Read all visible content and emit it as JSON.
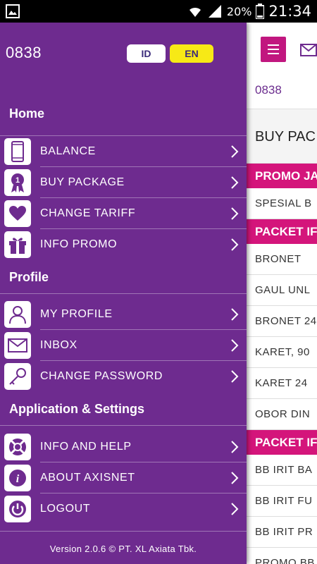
{
  "status_bar": {
    "battery_percent": "20%",
    "time": "21:34",
    "icons": [
      "gallery-icon",
      "wifi-icon",
      "signal-icon",
      "battery-icon"
    ]
  },
  "drawer": {
    "phone_number": "0838",
    "languages": {
      "id": "ID",
      "en": "EN",
      "selected": "EN"
    },
    "sections": [
      {
        "title": "Home"
      },
      {
        "title": "Profile"
      },
      {
        "title": "Application & Settings"
      }
    ],
    "items": [
      {
        "label": "BALANCE",
        "icon": "phone-icon"
      },
      {
        "label": "BUY PACKAGE",
        "icon": "badge-icon"
      },
      {
        "label": "CHANGE TARIFF",
        "icon": "heart-icon"
      },
      {
        "label": "INFO PROMO",
        "icon": "gift-icon"
      },
      {
        "label": "MY PROFILE",
        "icon": "user-icon"
      },
      {
        "label": "INBOX",
        "icon": "envelope-icon"
      },
      {
        "label": "CHANGE PASSWORD",
        "icon": "key-icon"
      },
      {
        "label": "INFO AND HELP",
        "icon": "lifebuoy-icon"
      },
      {
        "label": "ABOUT AXISNET",
        "icon": "info-icon"
      },
      {
        "label": "LOGOUT",
        "icon": "power-icon"
      }
    ],
    "version": "Version 2.0.6 © PT. XL Axiata Tbk."
  },
  "main": {
    "number": "0838",
    "title": "BUY PAC",
    "list": {
      "sections": [
        {
          "header": "PROMO JA",
          "rows": [
            "SPESIAL B"
          ]
        },
        {
          "header": "PACKET IF",
          "rows": [
            "BRONET",
            "GAUL UNL",
            "BRONET 24",
            "KARET, 90",
            "KARET 24",
            "OBOR DIN"
          ]
        },
        {
          "header": "PACKET IF",
          "rows": [
            "BB IRIT BA",
            "BB IRIT FU",
            "BB IRIT PR",
            "PROMO BB"
          ]
        }
      ]
    }
  },
  "colors": {
    "drawer_bg": "#6e2b8f",
    "accent_magenta": "#d4157b",
    "en_yellow": "#f7e916"
  }
}
